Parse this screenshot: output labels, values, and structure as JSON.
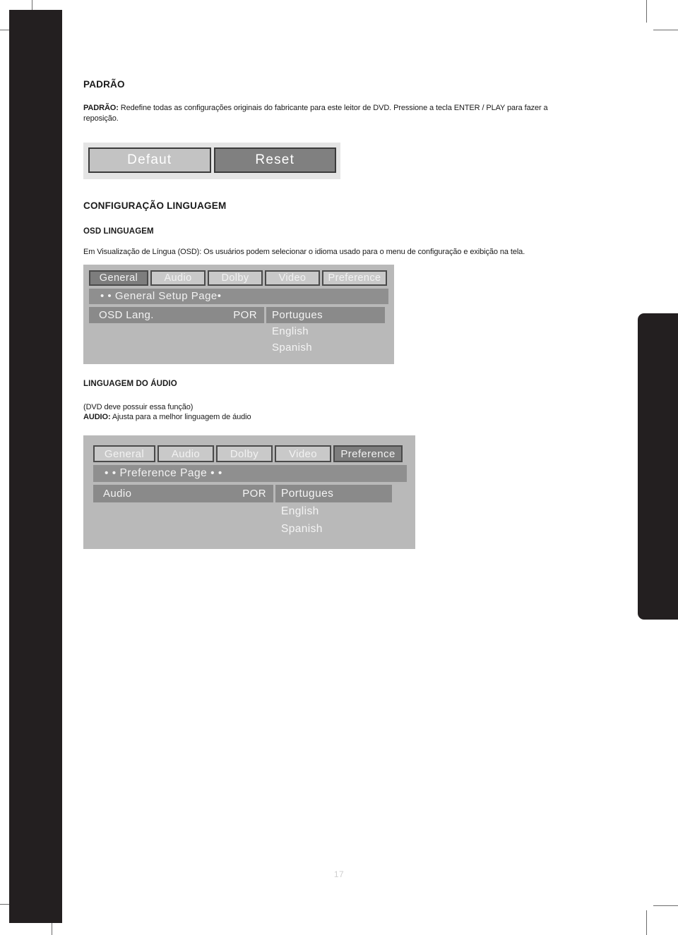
{
  "document": {
    "page_number": "17"
  },
  "sections": {
    "padrao": {
      "heading": "PADRÃO",
      "body_label": "PADRÃO:",
      "body_text": " Redefine todas as configurações originais do fabricante para este leitor de DVD. Pressione a tecla ENTER / PLAY para fazer a reposição."
    },
    "config_linguagem": {
      "heading": "CONFIGURAÇÃO LINGUAGEM",
      "sub_heading": "OSD LINGUAGEM",
      "body_text": "Em Visualização de Língua (OSD): Os usuários podem selecionar o idioma usado para o menu de configuração e exibição na tela."
    },
    "linguagem_audio": {
      "heading": "LINGUAGEM DO ÁUDIO",
      "note": "(DVD deve possuir essa função)",
      "body_label": "AUDIO:",
      "body_text": " Ajusta para a melhor linguagem de áudio"
    }
  },
  "default_osd": {
    "buttons": [
      {
        "label": "Defaut",
        "state": "normal"
      },
      {
        "label": "Reset",
        "state": "highlighted"
      }
    ]
  },
  "general_setup_osd": {
    "tabs": [
      {
        "label": "General",
        "active": true
      },
      {
        "label": "Audio",
        "active": false
      },
      {
        "label": "Dolby",
        "active": false
      },
      {
        "label": "Video",
        "active": false
      },
      {
        "label": "Preference",
        "active": false
      }
    ],
    "page_bar": "• • General Setup Page•",
    "option": {
      "name": "OSD Lang.",
      "value": "POR"
    },
    "choices": [
      {
        "label": "Portugues",
        "selected": true
      },
      {
        "label": "English",
        "selected": false
      },
      {
        "label": "Spanish",
        "selected": false
      }
    ]
  },
  "preference_osd": {
    "tabs": [
      {
        "label": "General",
        "active": false
      },
      {
        "label": "Audio",
        "active": false
      },
      {
        "label": "Dolby",
        "active": false
      },
      {
        "label": "Video",
        "active": false
      },
      {
        "label": "Preference",
        "active": true
      }
    ],
    "page_bar": "• • Preference Page • •",
    "option": {
      "name": "Audio",
      "value": "POR"
    },
    "choices": [
      {
        "label": "Portugues",
        "selected": true
      },
      {
        "label": "English",
        "selected": false
      },
      {
        "label": "Spanish",
        "selected": false
      }
    ]
  },
  "colors": {
    "bleed_black": "#231f20",
    "osd_screen_bg": "#b9b9b9",
    "osd_highlight": "#7d7d7d",
    "osd_tab": "#c9c9c9",
    "strip_bg": "#e4e4e4"
  }
}
